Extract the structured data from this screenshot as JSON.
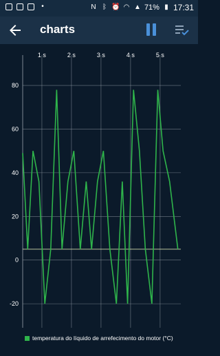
{
  "status_bar": {
    "battery": "71%",
    "time": "17:31",
    "icons": [
      "screenshot-icon",
      "image-icon",
      "gallery-icon",
      "dot-icon",
      "nfc-icon",
      "bluetooth-icon",
      "alarm-icon",
      "wifi-icon",
      "signal-icon",
      "battery-icon"
    ]
  },
  "toolbar": {
    "title": "charts",
    "back_icon": "arrow-left-icon",
    "pause_icon": "pause-icon",
    "list_icon": "playlist-check-icon"
  },
  "colors": {
    "background": "#0b1a2a",
    "toolbar": "#1b3147",
    "accent": "#4a90d9",
    "series": "#2fb44b",
    "grid": "#9aa4ad"
  },
  "chart_data": {
    "type": "line",
    "x_tick_labels": [
      "1 s",
      "2 s",
      "3 s",
      "4 s",
      "5 s"
    ],
    "x_ticks": [
      1,
      2,
      3,
      4,
      5
    ],
    "xlim": [
      0.35,
      5.7
    ],
    "y_tick_labels": [
      "80",
      "60",
      "40",
      "20",
      "0",
      "-20"
    ],
    "y_ticks": [
      80,
      60,
      40,
      20,
      0,
      -20
    ],
    "ylim": [
      -31,
      92
    ],
    "baseline": 5,
    "grid": true,
    "legend_position": "bottom-left",
    "series": [
      {
        "name": "temperatura do líquido de arrefecimento do motor (°C)",
        "x": [
          0.35,
          0.52,
          0.7,
          0.9,
          1.1,
          1.3,
          1.5,
          1.68,
          1.88,
          2.08,
          2.3,
          2.5,
          2.68,
          2.88,
          3.08,
          3.3,
          3.52,
          3.72,
          3.9,
          4.1,
          4.3,
          4.5,
          4.72,
          4.92,
          5.1,
          5.32,
          5.6
        ],
        "y": [
          49,
          5,
          50,
          36,
          -20,
          5,
          78,
          5,
          36,
          50,
          5,
          36,
          5,
          36,
          50,
          5,
          -20,
          36,
          -20,
          78,
          50,
          5,
          -20,
          78,
          50,
          36,
          5
        ]
      }
    ]
  }
}
